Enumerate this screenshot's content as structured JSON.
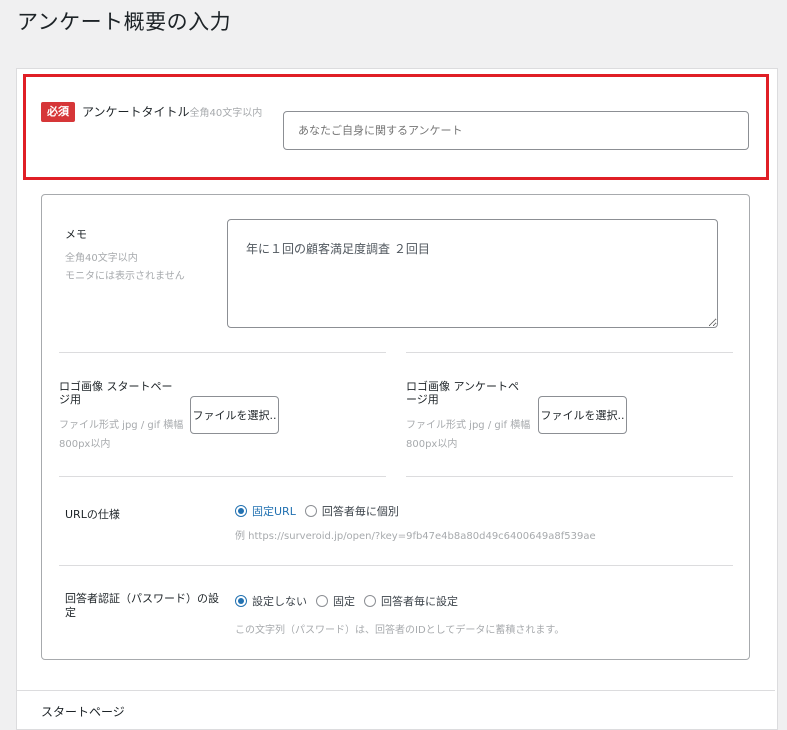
{
  "page": {
    "title": "アンケート概要の入力"
  },
  "survey_title": {
    "required_badge": "必須",
    "label": "アンケートタイトル",
    "hint": "全角40文字以内",
    "placeholder": "あなたご自身に関するアンケート"
  },
  "memo": {
    "label": "メモ",
    "hint_line1": "全角40文字以内",
    "hint_line2": "モニタには表示されません",
    "value": "年に１回の顧客満足度調査 ２回目"
  },
  "logo_start": {
    "label": "ロゴ画像 スタートページ用",
    "hint": "ファイル形式 jpg / gif 横幅800px以内",
    "button": "ファイルを選択.."
  },
  "logo_survey": {
    "label": "ロゴ画像 アンケートページ用",
    "hint": "ファイル形式 jpg / gif 横幅800px以内",
    "button": "ファイルを選択.."
  },
  "url_spec": {
    "label": "URLの仕様",
    "options": [
      "固定URL",
      "回答者毎に個別"
    ],
    "selected": "固定URL",
    "example": "例 https://surveroid.jp/open/?key=9fb47e4b8a80d49c6400649a8f539ae"
  },
  "auth": {
    "label": "回答者認証（パスワード）の設定",
    "options": [
      "設定しない",
      "固定",
      "回答者毎に設定"
    ],
    "selected": "設定しない",
    "note": "この文字列（パスワード）は、回答者のIDとしてデータに蓄積されます。"
  },
  "next_section": {
    "label": "スタートページ"
  },
  "colors": {
    "accent": "#2271b1",
    "required": "#d63638",
    "highlight": "#e01f26"
  }
}
